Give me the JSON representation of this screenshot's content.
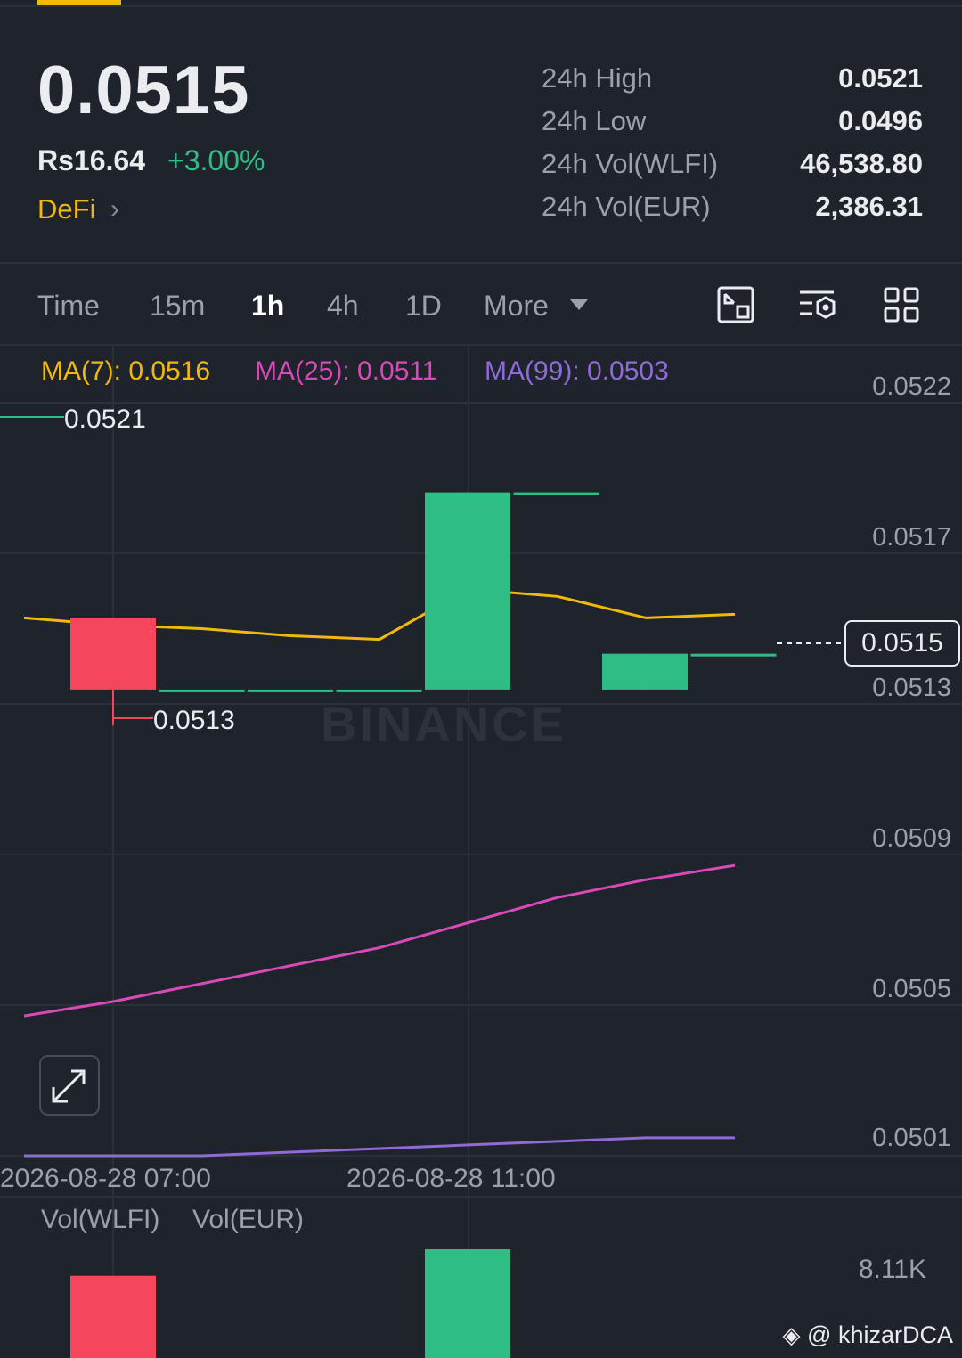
{
  "header": {
    "last_price": "0.0515",
    "fiat_price": "Rs16.64",
    "change_pct": "+3.00%",
    "tag": "DeFi",
    "stats": [
      {
        "label": "24h High",
        "value": "0.0521"
      },
      {
        "label": "24h Low",
        "value": "0.0496"
      },
      {
        "label": "24h Vol(WLFI)",
        "value": "46,538.80"
      },
      {
        "label": "24h Vol(EUR)",
        "value": "2,386.31"
      }
    ]
  },
  "toolbar": {
    "timeframes": [
      "Time",
      "15m",
      "1h",
      "4h",
      "1D",
      "More"
    ],
    "active_timeframe": "1h",
    "icons": [
      "chart-type-icon",
      "indicator-settings-icon",
      "layout-grid-icon"
    ]
  },
  "indicators": {
    "ma7": "MA(7): 0.0516",
    "ma25": "MA(25): 0.0511",
    "ma99": "MA(99): 0.0503",
    "colors": {
      "ma7": "#f0b90b",
      "ma25": "#d84ab8",
      "ma99": "#8f6ad8"
    }
  },
  "chart": {
    "y_ticks": [
      "0.0522",
      "0.0517",
      "0.0513",
      "0.0509",
      "0.0505",
      "0.0501"
    ],
    "x_ticks": [
      "2026-08-28 07:00",
      "2026-08-28 11:00"
    ],
    "high_marker": "0.0521",
    "low_marker": "0.0513",
    "current_price": "0.0515",
    "watermark": "BINANCE",
    "colors": {
      "up": "#2ebd85",
      "down": "#f6465d"
    }
  },
  "chart_data": {
    "type": "candlestick",
    "interval": "1h",
    "ylim": [
      0.0501,
      0.0522
    ],
    "candles": [
      {
        "o": 0.0516,
        "h": 0.0516,
        "l": 0.0513,
        "c": 0.0514
      },
      {
        "o": 0.0514,
        "h": 0.0514,
        "l": 0.0514,
        "c": 0.0514
      },
      {
        "o": 0.0514,
        "h": 0.0514,
        "l": 0.0514,
        "c": 0.0514
      },
      {
        "o": 0.0514,
        "h": 0.0514,
        "l": 0.0514,
        "c": 0.0514
      },
      {
        "o": 0.0514,
        "h": 0.05195,
        "l": 0.0514,
        "c": 0.05195
      },
      {
        "o": 0.05195,
        "h": 0.05195,
        "l": 0.05195,
        "c": 0.05195
      },
      {
        "o": 0.0514,
        "h": 0.0515,
        "l": 0.0514,
        "c": 0.0515
      },
      {
        "o": 0.0515,
        "h": 0.0515,
        "l": 0.0515,
        "c": 0.0515
      }
    ],
    "series": [
      {
        "name": "MA(7)",
        "values": [
          0.0516,
          0.05158,
          0.05157,
          0.05155,
          0.05154,
          0.05168,
          0.05166,
          0.0516,
          0.05161
        ]
      },
      {
        "name": "MA(25)",
        "values": [
          0.05049,
          0.05053,
          0.05058,
          0.05063,
          0.05068,
          0.05075,
          0.05082,
          0.05087,
          0.05091
        ]
      },
      {
        "name": "MA(99)",
        "values": [
          0.0501,
          0.0501,
          0.0501,
          0.05011,
          0.05012,
          0.05013,
          0.05014,
          0.05015,
          0.05015
        ]
      }
    ]
  },
  "volume": {
    "label_wlfi": "Vol(WLFI)",
    "label_eur": "Vol(EUR)",
    "y_tick": "8.11K",
    "bars": [
      {
        "value": 5900,
        "up": false
      },
      {
        "value": 0,
        "up": true
      },
      {
        "value": 0,
        "up": true
      },
      {
        "value": 0,
        "up": true
      },
      {
        "value": 7800,
        "up": true
      },
      {
        "value": 0,
        "up": true
      },
      {
        "value": 0,
        "up": true
      },
      {
        "value": 0,
        "up": true
      }
    ]
  },
  "credit": "@ khizarDCA"
}
